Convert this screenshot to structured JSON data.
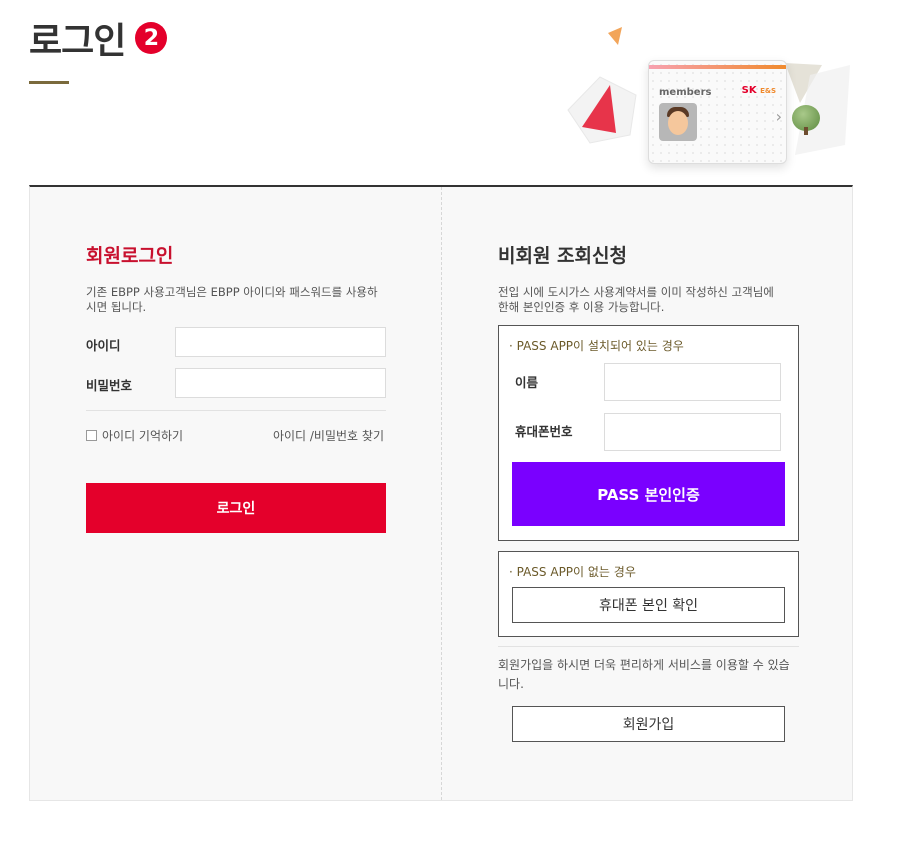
{
  "page": {
    "title": "로그인",
    "step_number": "2"
  },
  "hero": {
    "card_label": "members",
    "card_brand": "SK",
    "card_brand_sub": "E&S"
  },
  "member_login": {
    "title": "회원로그인",
    "description": "기존 EBPP 사용고객님은 EBPP 아이디와 패스워드를 사용하시면 됩니다.",
    "id_label": "아이디",
    "id_value": "",
    "password_label": "비밀번호",
    "password_value": "",
    "remember_label": "아이디 기억하기",
    "find_link": "아이디 /비밀번호 찾기",
    "login_button": "로그인"
  },
  "non_member": {
    "title": "비회원 조회신청",
    "description": "전입 시에 도시가스 사용계약서를 이미 작성하신 고객님에 한해 본인인증 후 이용 가능합니다.",
    "pass_installed": {
      "title": "· PASS APP이 설치되어 있는 경우",
      "name_label": "이름",
      "name_value": "",
      "phone_label": "휴대폰번호",
      "phone_value": "",
      "button": "PASS 본인인증"
    },
    "pass_missing": {
      "title": "· PASS APP이 없는 경우",
      "button": "휴대폰 본인 확인"
    },
    "signup_note": "회원가입을 하시면 더욱 편리하게 서비스를 이용할 수 있습니다.",
    "signup_button": "회원가입"
  },
  "colors": {
    "accent_red": "#e4002b",
    "pass_purple": "#7a00ff",
    "rule_gold": "#7a6a3c"
  }
}
